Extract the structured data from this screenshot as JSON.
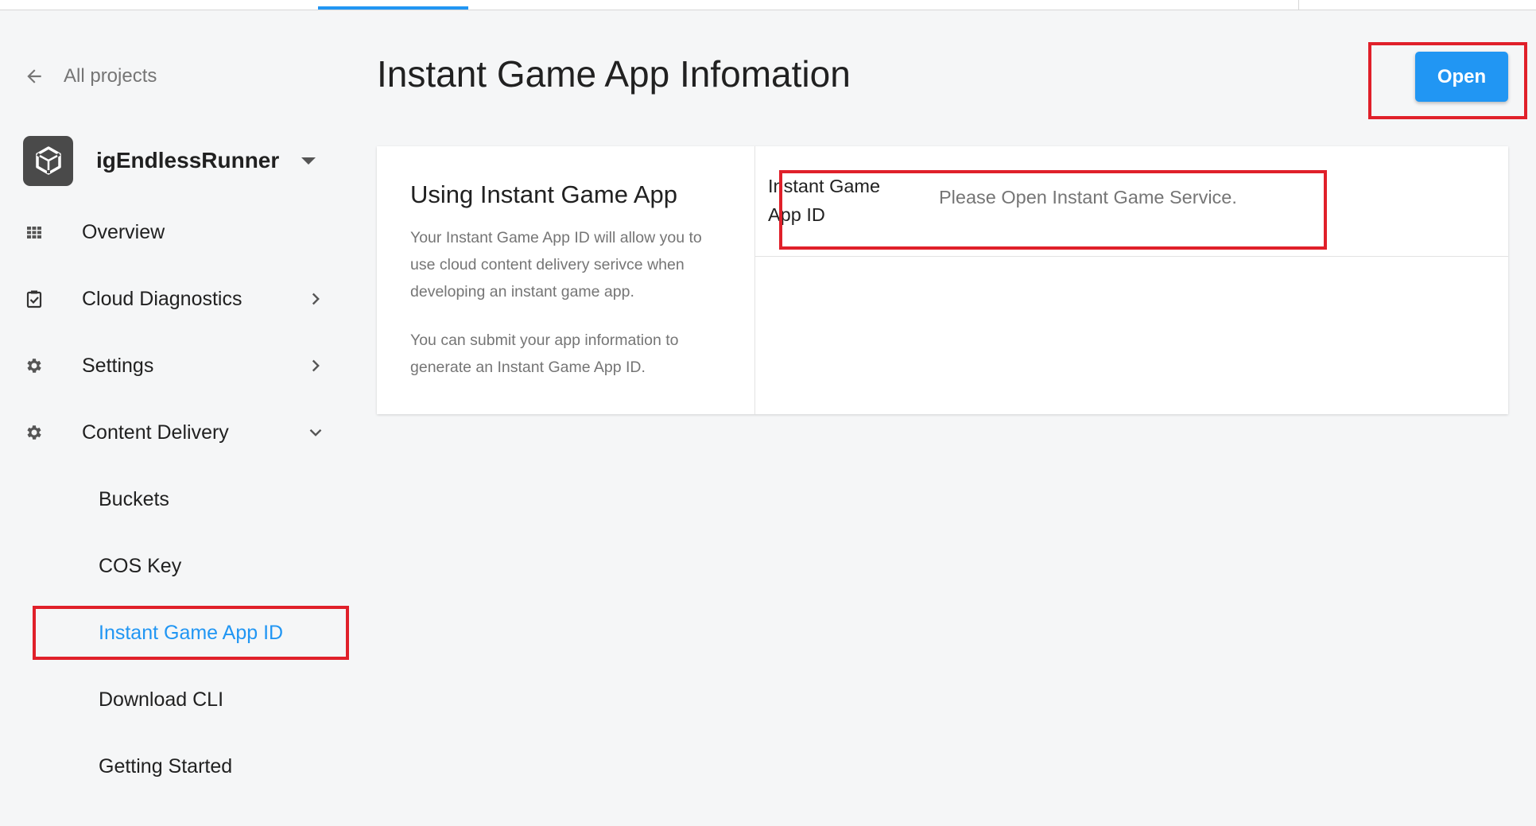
{
  "topbar": {
    "accent": "#2196f3"
  },
  "sidebar": {
    "back": {
      "label": "All projects",
      "icon": "arrow-left-icon"
    },
    "project": {
      "name": "igEndlessRunner",
      "icon": "unity-logo-icon"
    },
    "items": [
      {
        "label": "Overview",
        "icon": "grid-icon"
      },
      {
        "label": "Cloud Diagnostics",
        "icon": "clipboard-check-icon"
      },
      {
        "label": "Settings",
        "icon": "gear-icon"
      },
      {
        "label": "Content Delivery",
        "icon": "gear-icon"
      }
    ],
    "subitems": [
      {
        "label": "Buckets"
      },
      {
        "label": "COS Key"
      },
      {
        "label": "Instant Game App ID",
        "active": true
      },
      {
        "label": "Download CLI"
      },
      {
        "label": "Getting Started"
      }
    ]
  },
  "main": {
    "title": "Instant Game App Infomation",
    "open_label": "Open",
    "card": {
      "heading": "Using Instant Game App",
      "desc1": "Your Instant Game App ID will allow you to use cloud content delivery serivce when developing an instant game app.",
      "desc2": "You can submit your app information to generate an Instant Game App ID.",
      "field_label": "Instant Game App ID",
      "field_value": "Please Open Instant Game Service."
    }
  },
  "colors": {
    "accent": "#2196f3",
    "highlight": "#e0202a"
  }
}
